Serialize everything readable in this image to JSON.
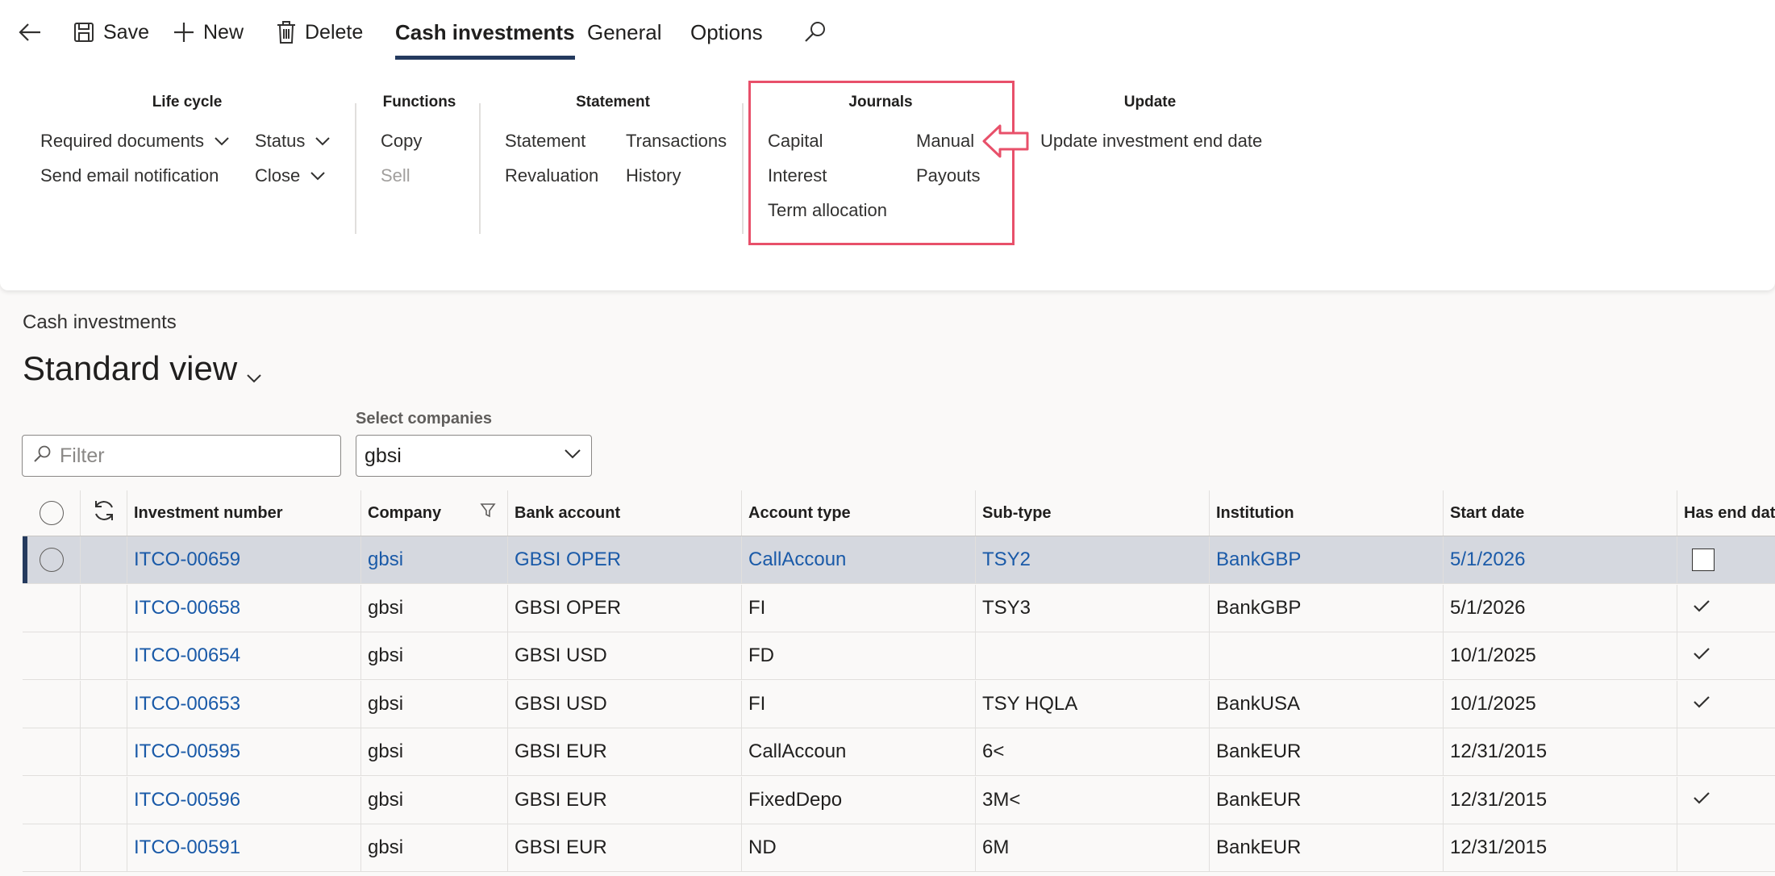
{
  "toolbar": {
    "back_icon": "back-arrow-icon",
    "save_label": "Save",
    "new_label": "New",
    "delete_label": "Delete",
    "tabs": [
      {
        "label": "Cash investments",
        "active": true
      },
      {
        "label": "General",
        "active": false
      },
      {
        "label": "Options",
        "active": false
      }
    ],
    "search_icon": "search-icon"
  },
  "ribbon": {
    "life_cycle": {
      "title": "Life cycle",
      "required_documents": "Required documents",
      "status": "Status",
      "send_email": "Send email notification",
      "close": "Close"
    },
    "functions": {
      "title": "Functions",
      "copy": "Copy",
      "sell": "Sell"
    },
    "statement": {
      "title": "Statement",
      "statement": "Statement",
      "transactions": "Transactions",
      "revaluation": "Revaluation",
      "history": "History"
    },
    "journals": {
      "title": "Journals",
      "capital": "Capital",
      "manual": "Manual",
      "interest": "Interest",
      "payouts": "Payouts",
      "term_allocation": "Term allocation"
    },
    "update": {
      "title": "Update",
      "update_end_date": "Update investment end date"
    },
    "highlight_color": "#e8506a"
  },
  "page": {
    "breadcrumb": "Cash investments",
    "view_title": "Standard view",
    "filter_placeholder": "Filter",
    "select_label": "Select companies",
    "select_value": "gbsi"
  },
  "grid": {
    "columns": [
      "Investment number",
      "Company",
      "Bank account",
      "Account type",
      "Sub-type",
      "Institution",
      "Start date",
      "Has end dat"
    ],
    "rows": [
      {
        "number": "ITCO-00659",
        "company": "gbsi",
        "bank": "GBSI OPER",
        "type": "CallAccoun",
        "subtype": "TSY2",
        "institution": "BankGBP",
        "start": "5/1/2026",
        "has_end": "box",
        "selected": true
      },
      {
        "number": "ITCO-00658",
        "company": "gbsi",
        "bank": "GBSI OPER",
        "type": "FI",
        "subtype": "TSY3",
        "institution": "BankGBP",
        "start": "5/1/2026",
        "has_end": "check",
        "selected": false
      },
      {
        "number": "ITCO-00654",
        "company": "gbsi",
        "bank": "GBSI USD",
        "type": "FD",
        "subtype": "",
        "institution": "",
        "start": "10/1/2025",
        "has_end": "check",
        "selected": false
      },
      {
        "number": "ITCO-00653",
        "company": "gbsi",
        "bank": "GBSI USD",
        "type": "FI",
        "subtype": "TSY HQLA",
        "institution": "BankUSA",
        "start": "10/1/2025",
        "has_end": "check",
        "selected": false
      },
      {
        "number": "ITCO-00595",
        "company": "gbsi",
        "bank": "GBSI EUR",
        "type": "CallAccoun",
        "subtype": "6<",
        "institution": "BankEUR",
        "start": "12/31/2015",
        "has_end": "",
        "selected": false
      },
      {
        "number": "ITCO-00596",
        "company": "gbsi",
        "bank": "GBSI EUR",
        "type": "FixedDepo",
        "subtype": "3M<",
        "institution": "BankEUR",
        "start": "12/31/2015",
        "has_end": "check",
        "selected": false
      },
      {
        "number": "ITCO-00591",
        "company": "gbsi",
        "bank": "GBSI EUR",
        "type": "ND",
        "subtype": "6M",
        "institution": "BankEUR",
        "start": "12/31/2015",
        "has_end": "",
        "selected": false
      }
    ]
  },
  "colors": {
    "accent": "#243a5e",
    "link": "#1a5aa8",
    "selected_row": "#d5d8df"
  }
}
